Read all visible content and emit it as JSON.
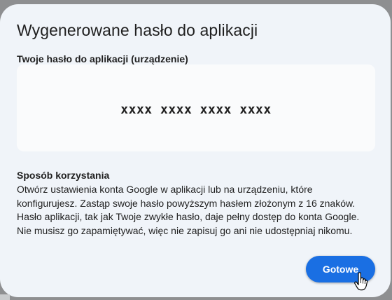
{
  "dialog": {
    "title": "Wygenerowane hasło do aplikacji",
    "password_label": "Twoje hasło do aplikacji (urządzenie)",
    "password_value": "xxxx xxxx xxxx xxxx",
    "usage_heading": "Sposób korzystania",
    "usage_lines": [
      "Otwórz ustawienia konta Google w aplikacji lub na urządzeniu, które",
      "konfigurujesz. Zastąp swoje hasło powyższym hasłem złożonym z 16 znaków.",
      "Hasło aplikacji, tak jak Twoje zwykłe hasło, daje pełny dostęp do konta Google.",
      "Nie musisz go zapamiętywać, więc nie zapisuj go ani nie udostępniaj nikomu."
    ],
    "done_button_label": "Gotowe"
  },
  "colors": {
    "dialog_background": "#f0f4f9",
    "password_box_background": "#fafbfc",
    "primary_button": "#1a6fe3",
    "overlay": "#8e8f91"
  },
  "icons": {
    "cursor": "hand-pointer-icon"
  }
}
